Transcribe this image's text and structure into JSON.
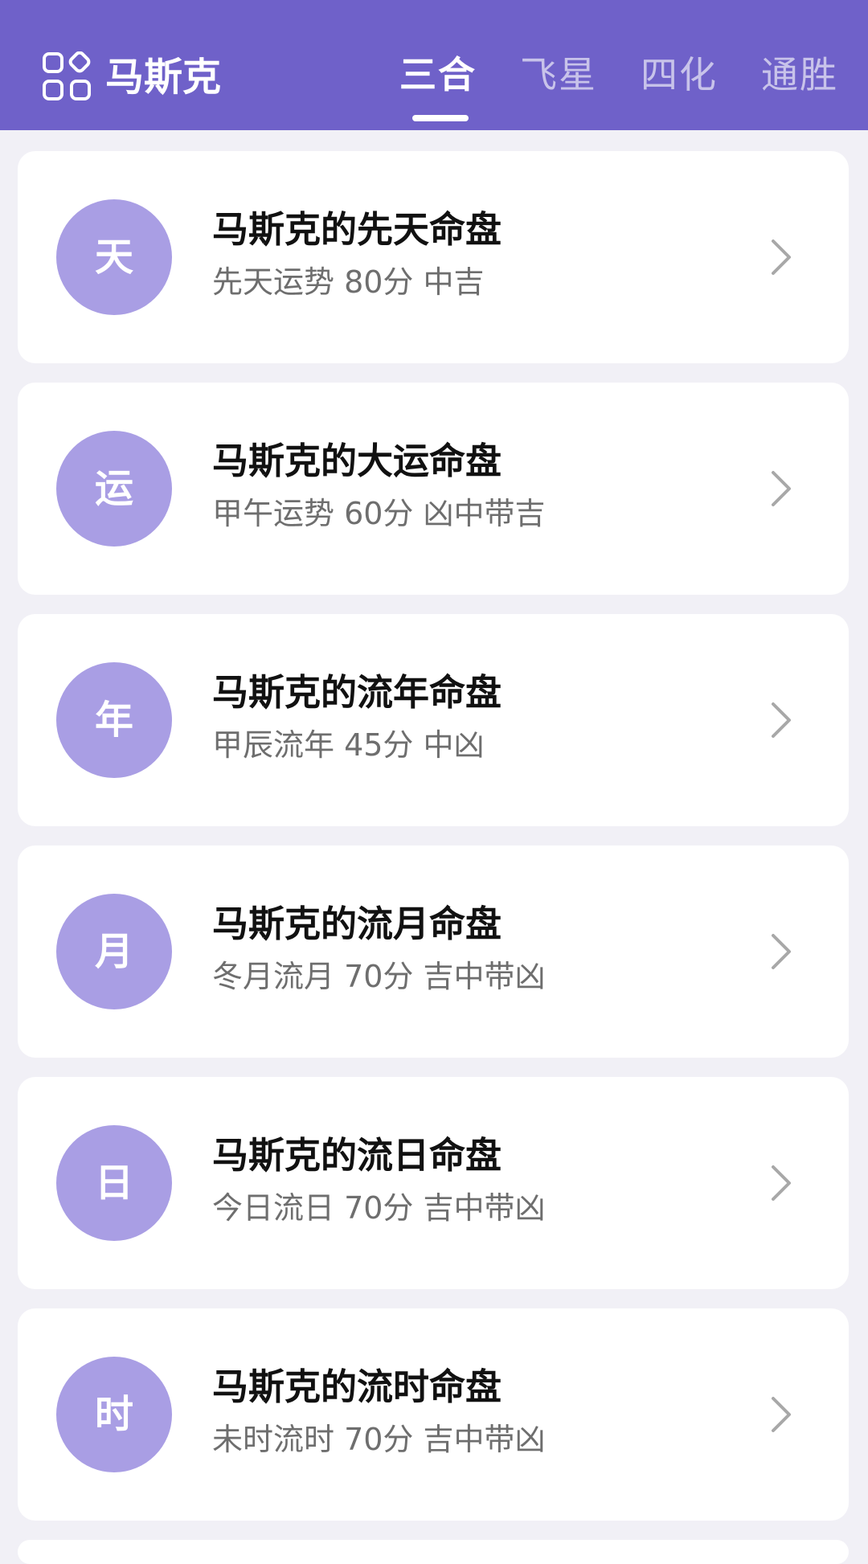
{
  "header": {
    "app_name": "马斯克",
    "tabs": [
      {
        "label": "三合",
        "active": true
      },
      {
        "label": "飞星",
        "active": false
      },
      {
        "label": "四化",
        "active": false
      },
      {
        "label": "通胜",
        "active": false
      }
    ]
  },
  "charts": [
    {
      "avatar": "天",
      "title": "马斯克的先天命盘",
      "subtitle": "先天运势  80分 中吉"
    },
    {
      "avatar": "运",
      "title": "马斯克的大运命盘",
      "subtitle": "甲午运势  60分 凶中带吉"
    },
    {
      "avatar": "年",
      "title": "马斯克的流年命盘",
      "subtitle": "甲辰流年  45分 中凶"
    },
    {
      "avatar": "月",
      "title": "马斯克的流月命盘",
      "subtitle": "冬月流月  70分 吉中带凶"
    },
    {
      "avatar": "日",
      "title": "马斯克的流日命盘",
      "subtitle": "今日流日  70分 吉中带凶"
    },
    {
      "avatar": "时",
      "title": "马斯克的流时命盘",
      "subtitle": "未时流时 70分 吉中带凶"
    }
  ],
  "colors": {
    "header_bg": "#6f61c9",
    "avatar_bg": "#a99ee4",
    "page_bg": "#f1f0f6"
  },
  "icons": {
    "apps": "apps-grid-icon",
    "chevron": "chevron-right-icon"
  }
}
